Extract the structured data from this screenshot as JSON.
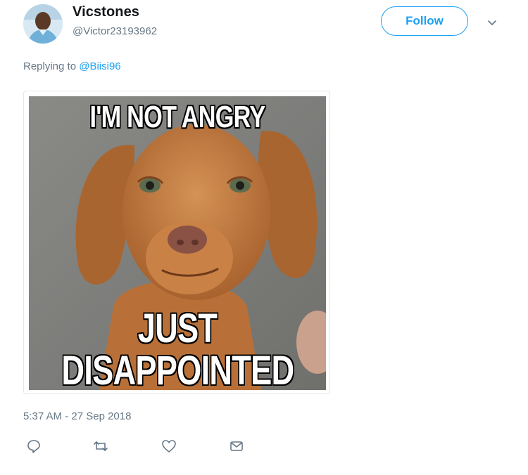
{
  "tweet": {
    "author": {
      "name": "Vicstones",
      "handle": "@Victor23193962"
    },
    "follow_label": "Follow",
    "reply": {
      "prefix": "Replying to ",
      "mention": "@Biisi96"
    },
    "media": {
      "top_text": "I'M NOT ANGRY",
      "bottom_text_line1": "JUST",
      "bottom_text_line2": "DISAPPOINTED"
    },
    "timestamp": "5:37 AM - 27 Sep 2018"
  },
  "icons": {
    "caret": "chevron-down-icon",
    "reply": "reply-icon",
    "retweet": "retweet-icon",
    "like": "heart-icon",
    "dm": "envelope-icon"
  },
  "colors": {
    "accent": "#1da1f2",
    "secondary_text": "#657786",
    "primary_text": "#14171a"
  }
}
